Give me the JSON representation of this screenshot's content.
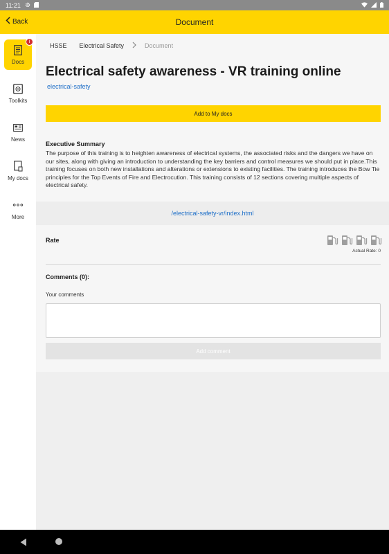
{
  "status_bar": {
    "time": "11:21"
  },
  "app_bar": {
    "back_label": "Back",
    "title": "Document"
  },
  "sidebar": {
    "items": [
      {
        "label": "Docs",
        "icon": "doc-icon",
        "badge": "i"
      },
      {
        "label": "Toolkits",
        "icon": "toolkit-icon"
      },
      {
        "label": "News",
        "icon": "news-icon"
      },
      {
        "label": "My docs",
        "icon": "my-docs-icon"
      },
      {
        "label": "More",
        "icon": "more-icon"
      }
    ]
  },
  "breadcrumb": {
    "items": [
      "HSSE",
      "Electrical Safety"
    ],
    "current": "Document"
  },
  "document": {
    "title": "Electrical safety awareness - VR training online",
    "tag": "electrical-safety",
    "add_button": "Add to My docs",
    "summary_heading": "Executive Summary",
    "summary": "The purpose of this training is to heighten awareness of electrical systems, the associated risks and the dangers we have on our sites, along with giving an introduction to understanding the key barriers and control measures we should put in place.This training focuses on both new installations and alterations or extensions to existing facilities. The training introduces the Bow Tie principles for the Top Events of Fire and Electrocution. This training consists of 12 sections covering multiple aspects of electrical safety.",
    "file_link": "/electrical-safety-vr/index.html"
  },
  "rating": {
    "label": "Rate",
    "actual_rate_text": "Actual Rate: 0",
    "value": 0,
    "max": 4,
    "icon": "fuel-pump-icon"
  },
  "comments": {
    "heading": "Comments (0):",
    "input_label": "Your comments",
    "input_value": "",
    "submit_label": "Add comment"
  },
  "colors": {
    "accent": "#ffd400",
    "link": "#1e6fc8",
    "badge": "#d32f2f"
  }
}
